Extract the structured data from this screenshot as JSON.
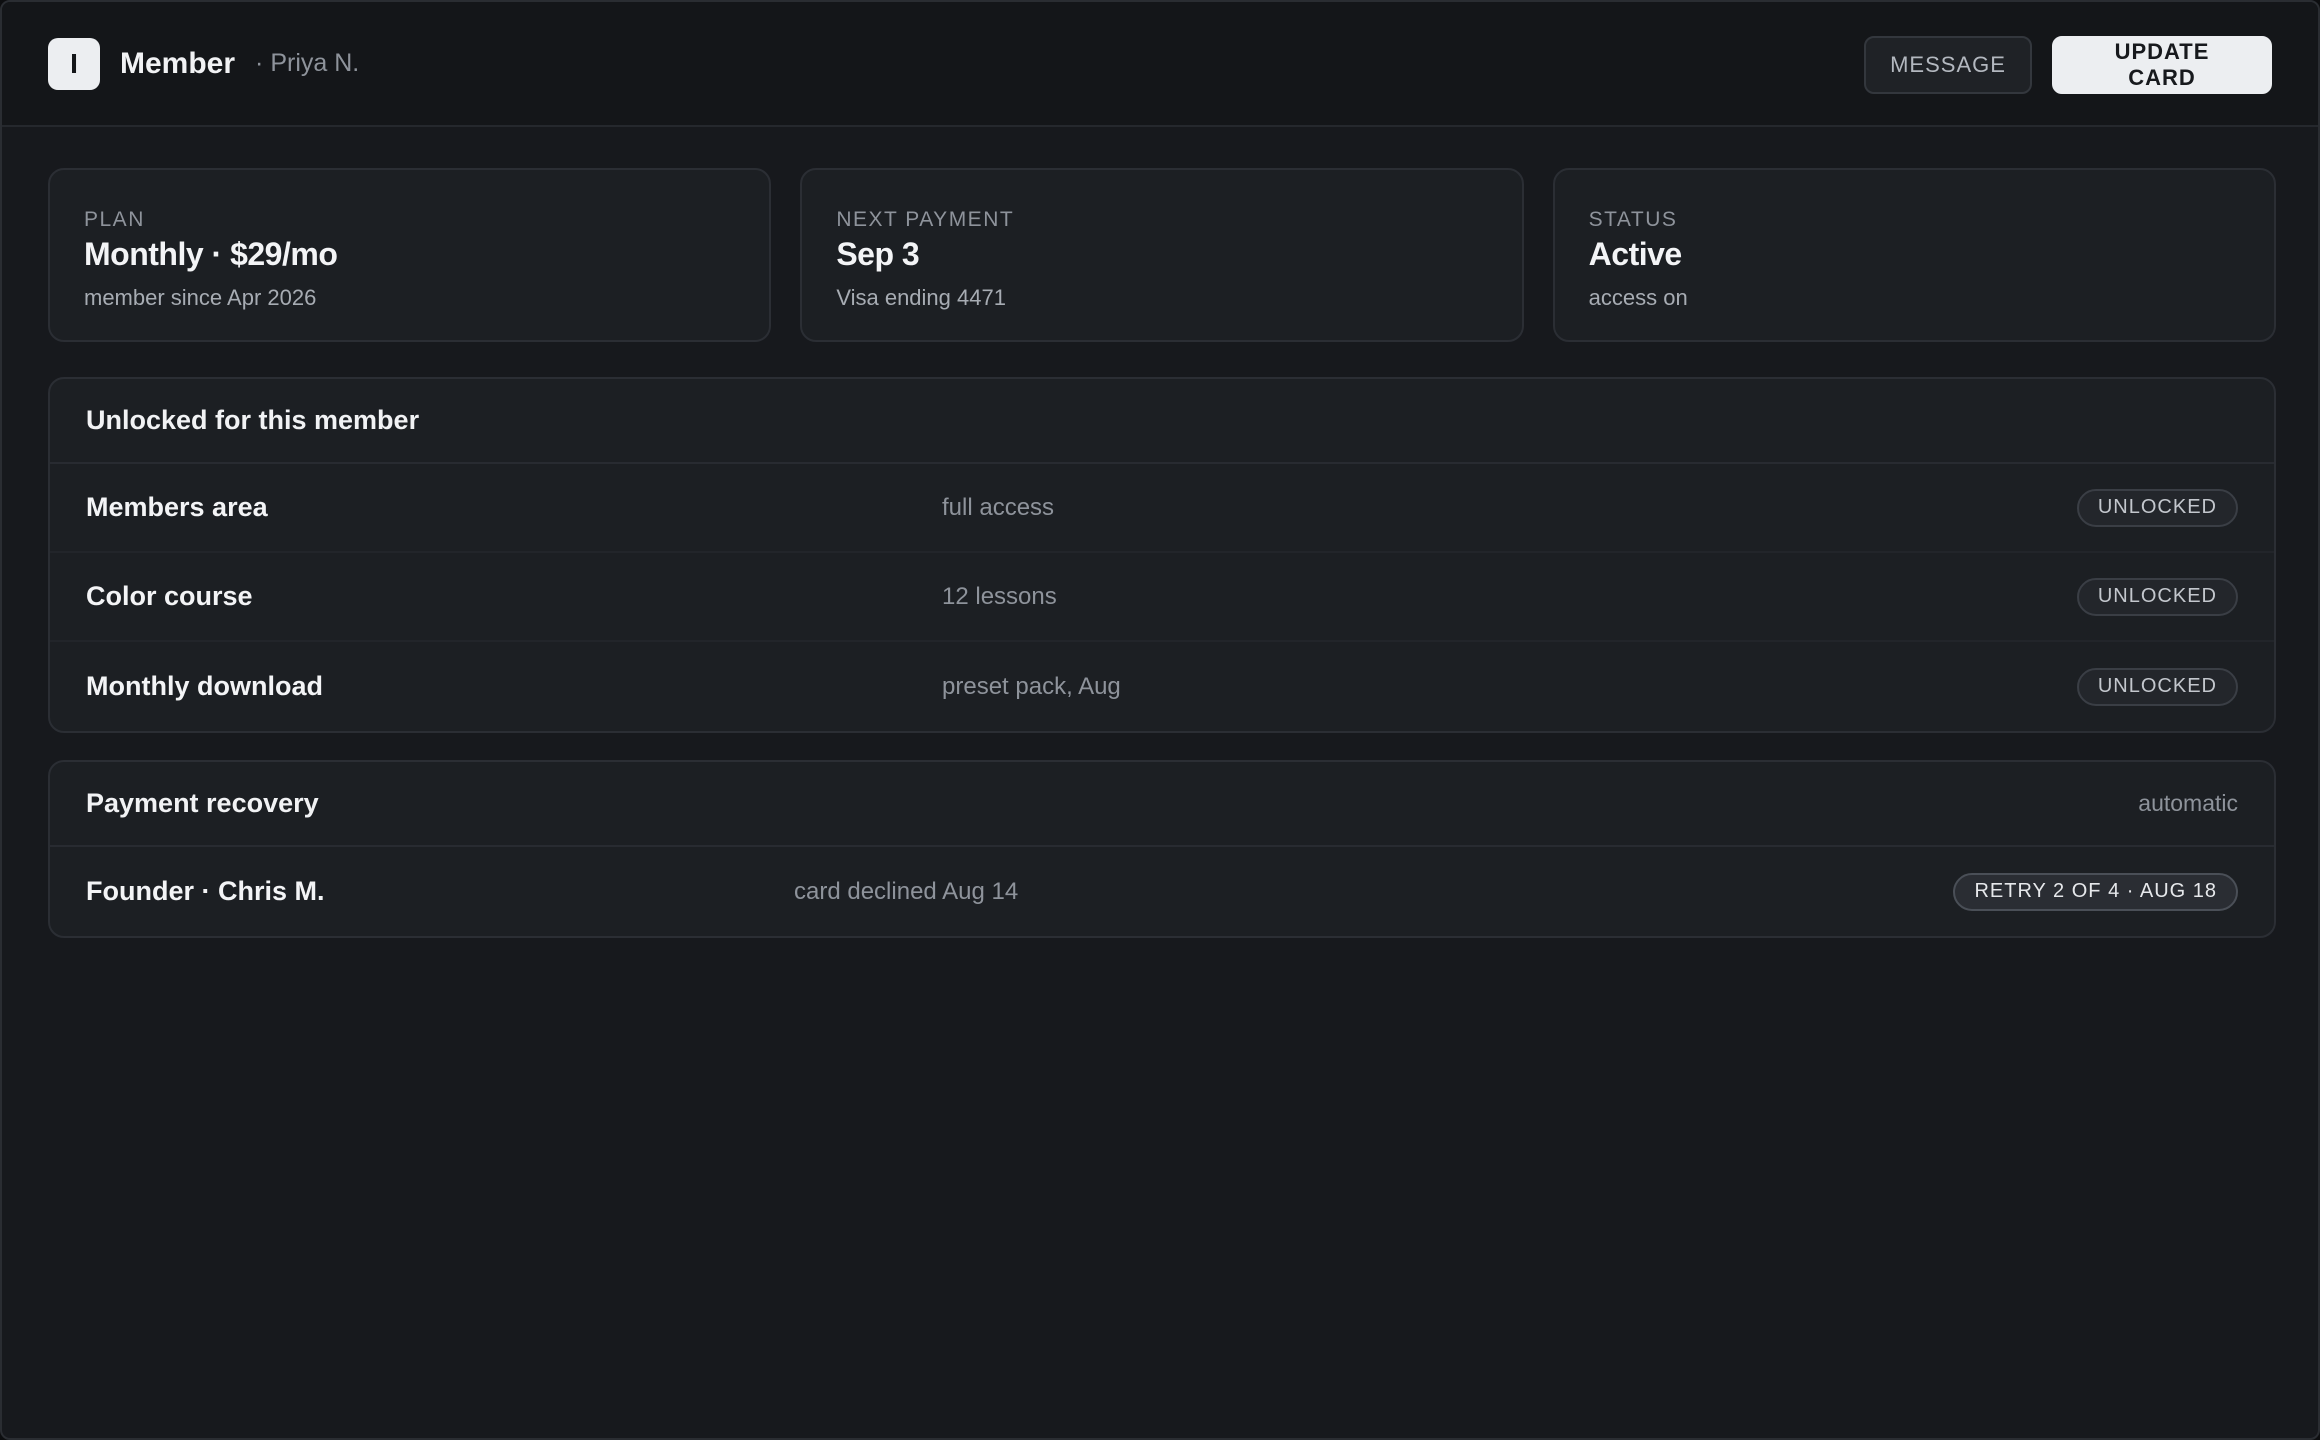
{
  "header": {
    "logo_letter": "I",
    "title": "Member",
    "subtitle": "· Priya N.",
    "message_label": "MESSAGE",
    "update_card_label": "UPDATE CARD"
  },
  "stats": {
    "plan": {
      "label": "PLAN",
      "value": "Monthly · $29/mo",
      "sub": "member since Apr 2026"
    },
    "next_payment": {
      "label": "NEXT PAYMENT",
      "value": "Sep 3",
      "sub": "Visa ending 4471"
    },
    "status": {
      "label": "STATUS",
      "value": "Active",
      "sub": "access on"
    }
  },
  "unlocked": {
    "title": "Unlocked for this member",
    "items": [
      {
        "name": "Members area",
        "detail": "full access",
        "badge": "UNLOCKED"
      },
      {
        "name": "Color course",
        "detail": "12 lessons",
        "badge": "UNLOCKED"
      },
      {
        "name": "Monthly download",
        "detail": "preset pack, Aug",
        "badge": "UNLOCKED"
      }
    ]
  },
  "recovery": {
    "title": "Payment recovery",
    "meta": "automatic",
    "items": [
      {
        "name": "Founder · Chris M.",
        "detail": "card declined Aug 14",
        "badge": "RETRY 2 OF 4 · AUG 18"
      }
    ]
  }
}
